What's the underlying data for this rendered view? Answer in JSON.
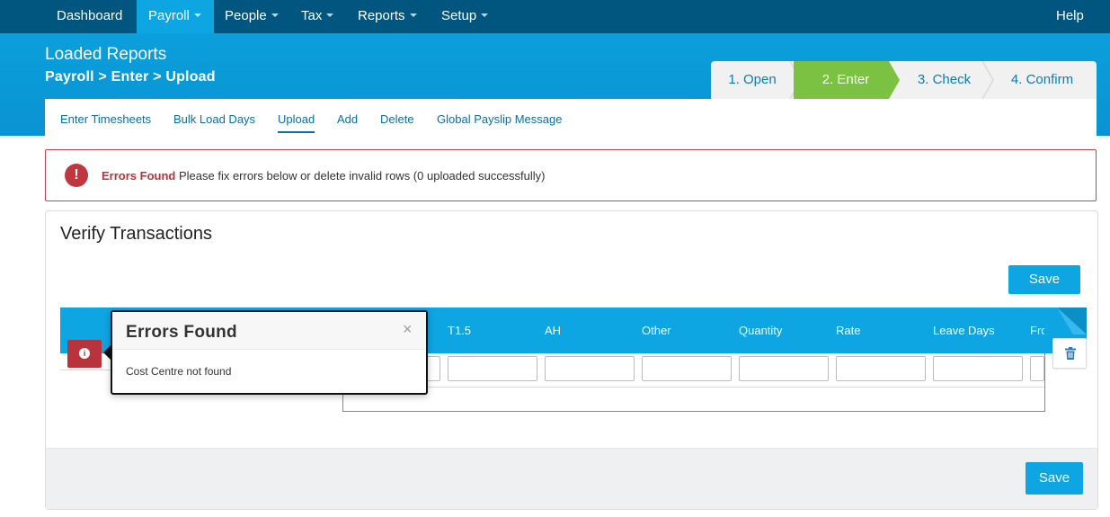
{
  "navbar": {
    "items": [
      {
        "label": "Dashboard"
      },
      {
        "label": "Payroll"
      },
      {
        "label": "People"
      },
      {
        "label": "Tax"
      },
      {
        "label": "Reports"
      },
      {
        "label": "Setup"
      }
    ],
    "help_label": "Help"
  },
  "header": {
    "title": "Loaded Reports",
    "breadcrumb": "Payroll > Enter > Upload"
  },
  "steps": [
    {
      "label": "1. Open"
    },
    {
      "label": "2. Enter"
    },
    {
      "label": "3. Check"
    },
    {
      "label": "4. Confirm"
    }
  ],
  "subnav": [
    {
      "label": "Enter Timesheets"
    },
    {
      "label": "Bulk Load Days"
    },
    {
      "label": "Upload"
    },
    {
      "label": "Add"
    },
    {
      "label": "Delete"
    },
    {
      "label": "Global Payslip Message"
    }
  ],
  "alert": {
    "icon": "exclamation-icon",
    "glyph": "!",
    "title": "Errors Found",
    "message": "Please fix errors below or delete invalid rows (0 uploaded successfully)"
  },
  "panel": {
    "title": "Verify Transactions",
    "save_label": "Save",
    "footer_save_label": "Save"
  },
  "grid": {
    "columns": [
      "T1.5",
      "AH",
      "Other",
      "Quantity",
      "Rate",
      "Leave Days",
      "Fro"
    ],
    "row_values": [
      "",
      "",
      "",
      "",
      "",
      "",
      ""
    ]
  },
  "popover": {
    "title": "Errors Found",
    "close_glyph": "×",
    "message": "Cost Centre not found"
  },
  "colors": {
    "navbar": "#00567f",
    "accent": "#0ea5e3",
    "step_active": "#7bc142",
    "error": "#b8333b"
  }
}
